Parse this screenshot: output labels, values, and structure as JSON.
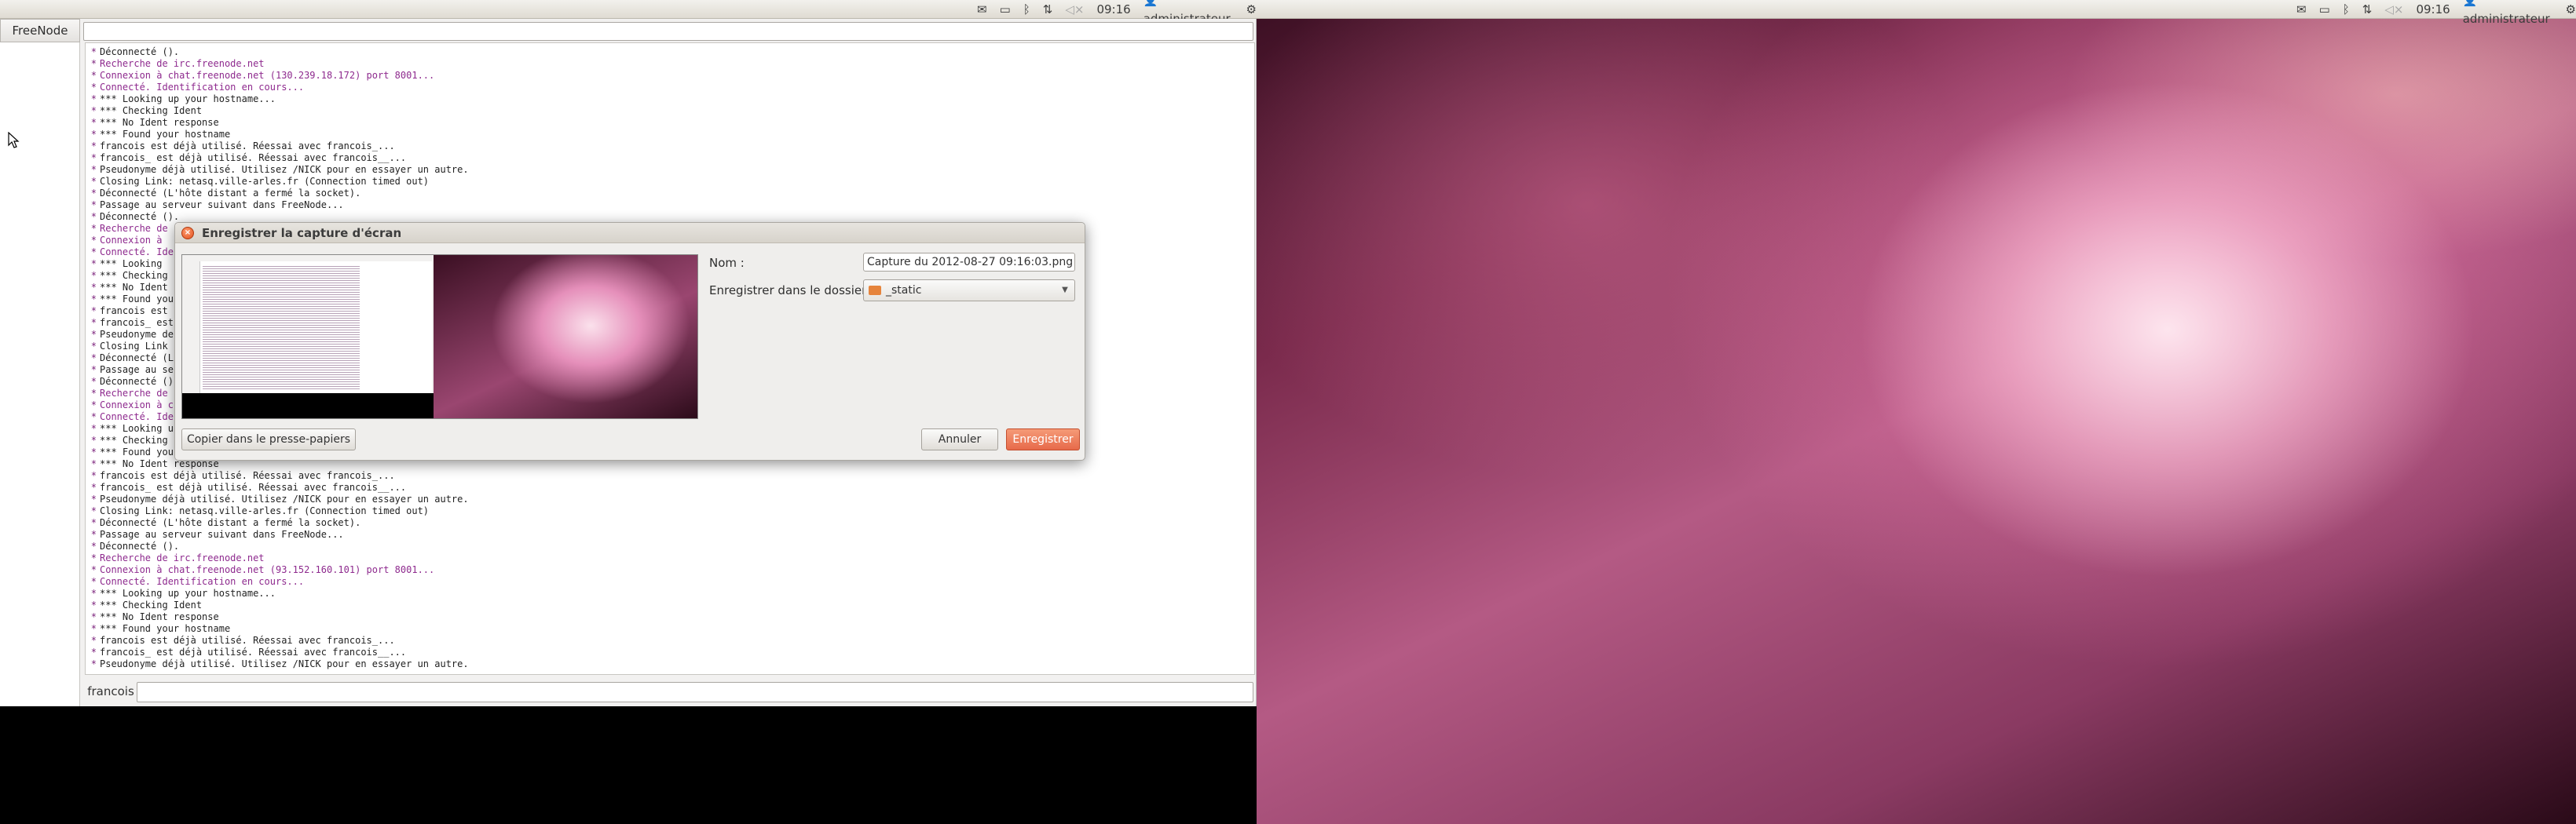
{
  "left_panel": {
    "mail_icon": "envelope-icon",
    "battery_icon": "battery-icon",
    "bluetooth_icon": "bluetooth-icon",
    "network_icon": "network-arrows-icon",
    "volume_icon": "speaker-muted-icon",
    "time": "09:16",
    "user": "administrateur",
    "session_icon": "gear-icon"
  },
  "right_panel": {
    "time": "09:16",
    "user": "administrateur"
  },
  "hexchat": {
    "server_tab": "FreeNode",
    "nick": "francois",
    "log": [
      {
        "c": "gray",
        "t": "Déconnecté ()."
      },
      {
        "c": "purple",
        "t": "Recherche de irc.freenode.net"
      },
      {
        "c": "purple",
        "t": "Connexion à chat.freenode.net (130.239.18.172) port 8001..."
      },
      {
        "c": "purple",
        "t": "Connecté. Identification en cours..."
      },
      {
        "c": "gray",
        "t": "*** Looking up your hostname..."
      },
      {
        "c": "gray",
        "t": "*** Checking Ident"
      },
      {
        "c": "gray",
        "t": "*** No Ident response"
      },
      {
        "c": "gray",
        "t": "*** Found your hostname"
      },
      {
        "c": "gray",
        "t": "francois est déjà utilisé. Réessai avec francois_..."
      },
      {
        "c": "gray",
        "t": "francois_ est déjà utilisé. Réessai avec francois__..."
      },
      {
        "c": "gray",
        "t": "Pseudonyme déjà utilisé. Utilisez /NICK pour en essayer un autre."
      },
      {
        "c": "gray",
        "t": "Closing Link: netasq.ville-arles.fr (Connection timed out)"
      },
      {
        "c": "gray",
        "t": "Déconnecté (L'hôte distant a fermé la socket)."
      },
      {
        "c": "gray",
        "t": "Passage au serveur suivant dans FreeNode..."
      },
      {
        "c": "gray",
        "t": "Déconnecté ()."
      },
      {
        "c": "purple",
        "t": "Recherche de"
      },
      {
        "c": "purple",
        "t": "Connexion à"
      },
      {
        "c": "purple",
        "t": "Connecté. Ide"
      },
      {
        "c": "gray",
        "t": "*** Looking"
      },
      {
        "c": "gray",
        "t": "*** Checking"
      },
      {
        "c": "gray",
        "t": "*** No Ident"
      },
      {
        "c": "gray",
        "t": "*** Found you"
      },
      {
        "c": "gray",
        "t": "francois est"
      },
      {
        "c": "gray",
        "t": "francois_ est"
      },
      {
        "c": "gray",
        "t": "Pseudonyme de"
      },
      {
        "c": "gray",
        "t": "Closing Link"
      },
      {
        "c": "gray",
        "t": "Déconnecté (L"
      },
      {
        "c": "gray",
        "t": "Passage au se"
      },
      {
        "c": "gray",
        "t": "Déconnecté ()"
      },
      {
        "c": "purple",
        "t": "Recherche de"
      },
      {
        "c": "purple",
        "t": "Connexion à c"
      },
      {
        "c": "purple",
        "t": "Connecté. Ide"
      },
      {
        "c": "gray",
        "t": "*** Looking u"
      },
      {
        "c": "gray",
        "t": "*** Checking"
      },
      {
        "c": "gray",
        "t": "*** Found you"
      },
      {
        "c": "gray",
        "t": "*** No Ident response"
      },
      {
        "c": "gray",
        "t": "francois est déjà utilisé. Réessai avec francois_..."
      },
      {
        "c": "gray",
        "t": "francois_ est déjà utilisé. Réessai avec francois__..."
      },
      {
        "c": "gray",
        "t": "Pseudonyme déjà utilisé. Utilisez /NICK pour en essayer un autre."
      },
      {
        "c": "gray",
        "t": "Closing Link: netasq.ville-arles.fr (Connection timed out)"
      },
      {
        "c": "gray",
        "t": "Déconnecté (L'hôte distant a fermé la socket)."
      },
      {
        "c": "gray",
        "t": "Passage au serveur suivant dans FreeNode..."
      },
      {
        "c": "gray",
        "t": "Déconnecté ()."
      },
      {
        "c": "purple",
        "t": "Recherche de irc.freenode.net"
      },
      {
        "c": "purple",
        "t": "Connexion à chat.freenode.net (93.152.160.101) port 8001..."
      },
      {
        "c": "purple",
        "t": "Connecté. Identification en cours..."
      },
      {
        "c": "gray",
        "t": "*** Looking up your hostname..."
      },
      {
        "c": "gray",
        "t": "*** Checking Ident"
      },
      {
        "c": "gray",
        "t": "*** No Ident response"
      },
      {
        "c": "gray",
        "t": "*** Found your hostname"
      },
      {
        "c": "gray",
        "t": "francois est déjà utilisé. Réessai avec francois_..."
      },
      {
        "c": "gray",
        "t": "francois_ est déjà utilisé. Réessai avec francois__..."
      },
      {
        "c": "gray",
        "t": "Pseudonyme déjà utilisé. Utilisez /NICK pour en essayer un autre."
      }
    ]
  },
  "dialog": {
    "title": "Enregistrer la capture d'écran",
    "name_label": "Nom :",
    "name_value": "Capture du 2012-08-27 09:16:03.png",
    "folder_label": "Enregistrer dans le dossier :",
    "folder_value": "_static",
    "copy_button": "Copier dans le presse-papiers",
    "cancel_button": "Annuler",
    "save_button": "Enregistrer"
  }
}
